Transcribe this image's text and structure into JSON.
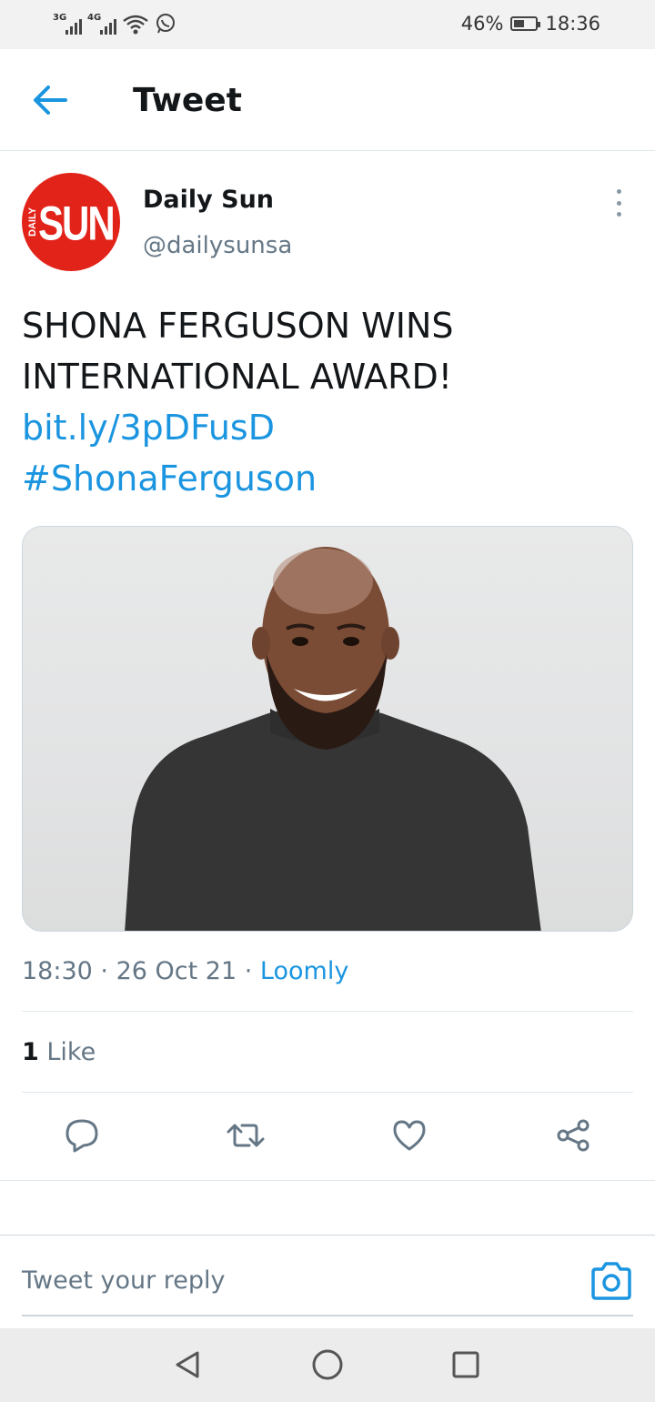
{
  "status_bar": {
    "network_1": "3G",
    "network_2": "4G",
    "battery_percent": "46%",
    "battery_level": 0.46,
    "time": "18:36"
  },
  "header": {
    "title": "Tweet"
  },
  "author": {
    "name": "Daily Sun",
    "handle": "@dailysunsa",
    "avatar_text": "SUN",
    "avatar_small_text": "DAILY",
    "avatar_color": "#e2231a"
  },
  "tweet": {
    "text_line_1": "SHONA FERGUSON WINS",
    "text_line_2": "INTERNATIONAL AWARD!",
    "link": "bit.ly/3pDFusD",
    "hashtag": "#ShonaFerguson"
  },
  "meta": {
    "time": "18:30",
    "date": "26 Oct 21",
    "source": "Loomly"
  },
  "engagement": {
    "like_count": "1",
    "like_label": "Like"
  },
  "actions": [
    "reply-icon",
    "retweet-icon",
    "like-icon",
    "share-icon"
  ],
  "reply_box": {
    "placeholder": "Tweet your reply"
  },
  "colors": {
    "accent": "#1b95e0",
    "text": "#14171a",
    "secondary": "#657786"
  }
}
